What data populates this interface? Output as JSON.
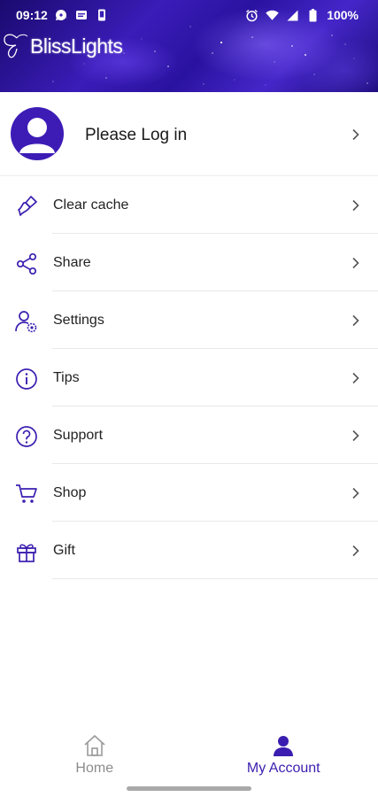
{
  "status_bar": {
    "time": "09:12",
    "battery": "100%",
    "left_icons": [
      "chat-icon",
      "message-icon",
      "phone-icon"
    ],
    "right_icons": [
      "alarm-icon",
      "wifi-icon",
      "signal-icon",
      "battery-icon"
    ]
  },
  "header": {
    "logo_text": "BlissLights"
  },
  "profile": {
    "label": "Please Log in"
  },
  "menu": {
    "items": [
      {
        "label": "Clear cache",
        "icon": "brush-icon"
      },
      {
        "label": "Share",
        "icon": "share-icon"
      },
      {
        "label": "Settings",
        "icon": "user-settings-icon"
      },
      {
        "label": "Tips",
        "icon": "info-icon"
      },
      {
        "label": "Support",
        "icon": "help-icon"
      },
      {
        "label": "Shop",
        "icon": "cart-icon"
      },
      {
        "label": "Gift",
        "icon": "gift-icon"
      }
    ]
  },
  "bottom_nav": {
    "tabs": [
      {
        "label": "Home",
        "icon": "home-icon",
        "active": false
      },
      {
        "label": "My Account",
        "icon": "account-icon",
        "active": true
      }
    ]
  },
  "colors": {
    "accent": "#3b1eb0",
    "header_dark": "#1a0a6e",
    "inactive": "#8c8c8c"
  }
}
